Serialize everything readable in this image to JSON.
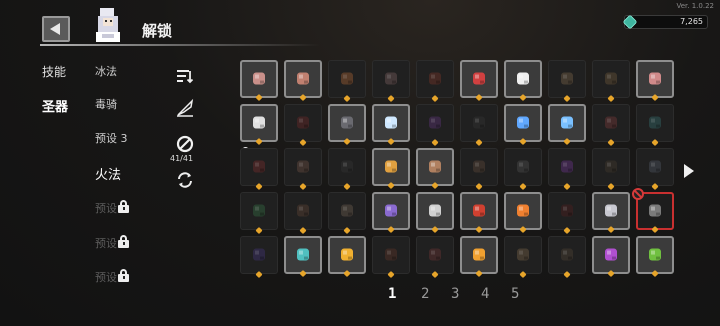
{
  "header": {
    "title": "解锁",
    "version": "Ver. 1.0.22",
    "currency": "7,265"
  },
  "categories": [
    {
      "id": "skills",
      "label": "技能"
    },
    {
      "id": "relics",
      "label": "圣器"
    }
  ],
  "presets": [
    {
      "label": "冰法",
      "state": "normal"
    },
    {
      "label": "毒骑",
      "state": "normal"
    },
    {
      "label": "预设 3",
      "state": "normal"
    },
    {
      "label": "火法",
      "state": "active"
    },
    {
      "label": "预设",
      "state": "locked"
    },
    {
      "label": "预设",
      "state": "locked"
    },
    {
      "label": "预设",
      "state": "locked"
    }
  ],
  "tools": {
    "sort_icon": "sort-icon",
    "filter_icon": "quill-icon",
    "ban_icon": "ban-icon",
    "count": "41/41",
    "refresh_icon": "refresh-icon"
  },
  "grid": {
    "rows": [
      [
        "owned:steak",
        "owned:pouch",
        "dim:shard",
        "dim:feather",
        "dim:potion",
        "owned:mask",
        "owned:skull",
        "dim:scroll",
        "dim:scroll2",
        "owned:ham"
      ],
      [
        "owned:sparkle",
        "dim:bat",
        "owned:rock",
        "owned:crystal",
        "dim:gem",
        "dim:orb",
        "owned:ice",
        "owned:mushroom",
        "dim:mushroom2",
        "dim:pills"
      ],
      [
        "dim:horn",
        "dim:urn",
        "dim:spoon",
        "owned:boomerang",
        "owned:plank",
        "dim:board",
        "dim:ball",
        "dim:flask",
        "dim:book",
        "dim:helmet"
      ],
      [
        "dim:ring",
        "dim:gun",
        "dim:hand",
        "owned:staff",
        "owned:swords",
        "owned:shield",
        "owned:cloth",
        "dim:wing",
        "owned:dagger",
        "selected:blade"
      ],
      [
        "dim:orb2",
        "owned:spider",
        "owned:gold",
        "dim:boot",
        "dim:cloak",
        "owned:coin",
        "dim:stone",
        "dim:disc",
        "owned:cauldron",
        "owned:clover"
      ]
    ],
    "locked_row": 2,
    "banned_cell": "3-9"
  },
  "pages": [
    "1",
    "2",
    "3",
    "4",
    "5"
  ],
  "current_page": "1",
  "colors": {
    "star": "#e7a52a",
    "selected_border": "#c93030",
    "currency_gem": "#3fb6a0"
  }
}
